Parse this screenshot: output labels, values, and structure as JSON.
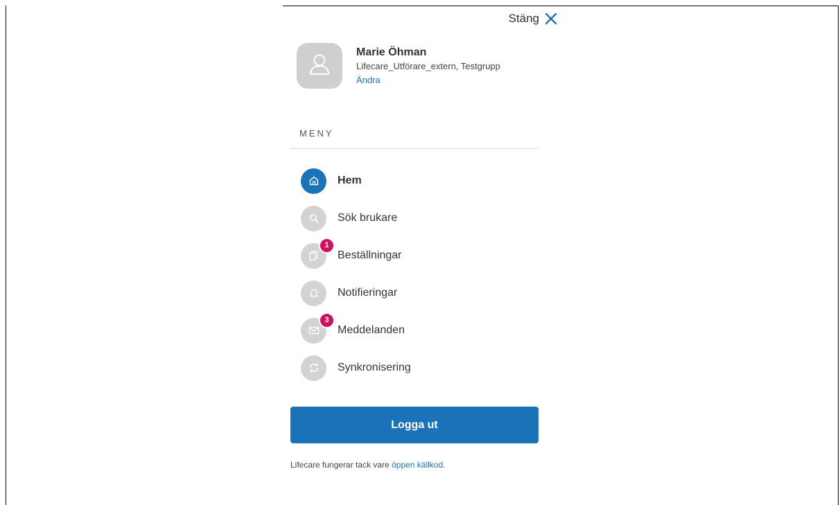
{
  "close": {
    "label": "Stäng",
    "icon": "close-icon"
  },
  "profile": {
    "name": "Marie Öhman",
    "org": "Lifecare_Utförare_extern, Testgrupp",
    "change_label": "Ändra",
    "avatar_icon": "user-icon"
  },
  "menu": {
    "heading": "MENY",
    "items": [
      {
        "label": "Hem",
        "icon": "home-icon",
        "active": true,
        "badge": ""
      },
      {
        "label": "Sök brukare",
        "icon": "search-icon",
        "active": false,
        "badge": ""
      },
      {
        "label": "Beställningar",
        "icon": "documents-icon",
        "active": false,
        "badge": "1"
      },
      {
        "label": "Notifieringar",
        "icon": "bell-icon",
        "active": false,
        "badge": ""
      },
      {
        "label": "Meddelanden",
        "icon": "mail-icon",
        "active": false,
        "badge": "3"
      },
      {
        "label": "Synkronisering",
        "icon": "sync-icon",
        "active": false,
        "badge": ""
      }
    ]
  },
  "logout": {
    "label": "Logga ut"
  },
  "footer": {
    "text": "Lifecare fungerar tack vare",
    "link": "öppen källkod."
  },
  "colors": {
    "accent": "#1a73b8",
    "badge": "#d0115f",
    "icon_inactive": "#d3d3d3"
  }
}
